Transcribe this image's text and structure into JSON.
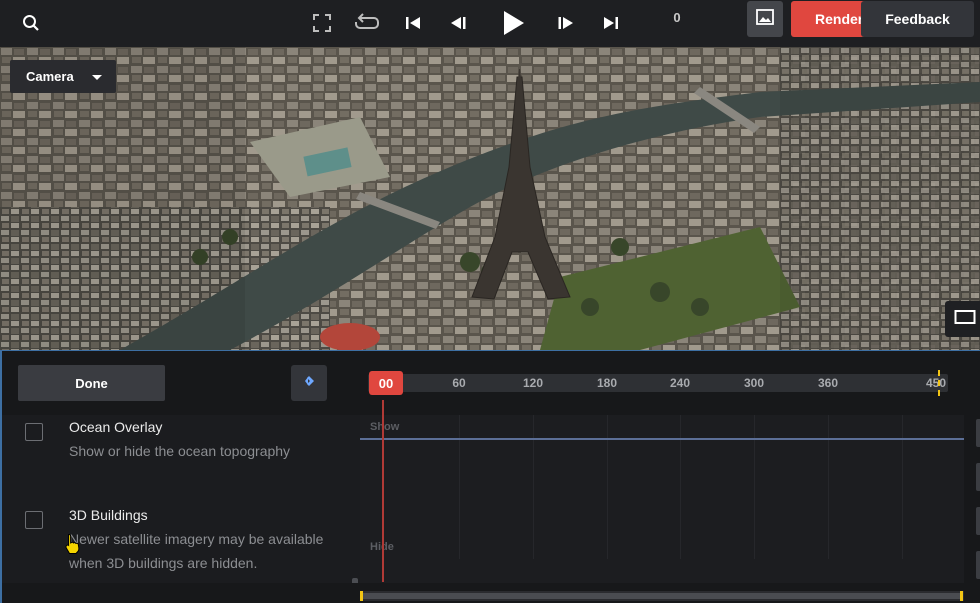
{
  "toolbar": {
    "frame_counter": "0",
    "render_label": "Render",
    "feedback_label": "Feedback",
    "icons": [
      "search-icon",
      "fullscreen-icon",
      "loop-icon",
      "skip-to-start-icon",
      "step-back-icon",
      "play-icon",
      "step-forward-icon",
      "skip-to-end-icon",
      "image-icon"
    ]
  },
  "viewport": {
    "camera_label": "Camera",
    "icons": [
      "chevron-down-icon",
      "aspect-ratio-icon"
    ]
  },
  "panel": {
    "done_label": "Done",
    "playhead_label": "00",
    "ruler_ticks": [
      "60",
      "120",
      "180",
      "240",
      "300",
      "360",
      "450"
    ],
    "properties": [
      {
        "title": "Ocean Overlay",
        "description": "Show or hide the ocean topography"
      },
      {
        "title": "3D Buildings",
        "description_line1": "Newer satellite imagery may be available",
        "description_line2": "when 3D buildings are hidden."
      }
    ],
    "track": {
      "top_label": "Show",
      "bottom_label": "Hide"
    }
  },
  "colors": {
    "accent_red": "#e0473f",
    "marker_yellow": "#f2c515",
    "selection_blue": "#3d6fa3",
    "track_line": "#5c6f97"
  }
}
